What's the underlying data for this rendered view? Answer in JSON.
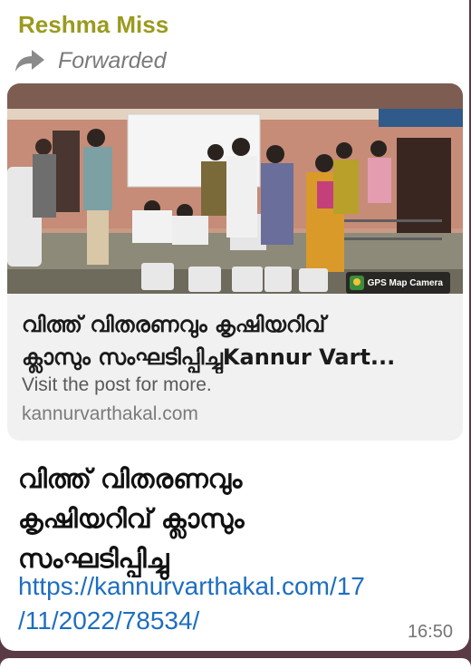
{
  "message": {
    "sender": "Reshma Miss",
    "forwarded_label": "Forwarded",
    "link_preview": {
      "photo_badge": "GPS Map Camera",
      "title_line1": "വിത്ത് വിതരണവും കൃഷിയറിവ്",
      "title_line2": "ക്ലാസും സംഘടിപ്പിച്ചുKannur Vart...",
      "description": "Visit the post for more.",
      "domain": "kannurvarthakal.com"
    },
    "text_lines": [
      "വിത്ത് വിതരണവും",
      "കൃഷിയറിവ് ക്ലാസും",
      "സംഘടിപ്പിച്ചു"
    ],
    "link_lines": [
      "https://kannurvarthakal.com/17",
      "/11/2022/78534/"
    ],
    "time": "16:50"
  },
  "colors": {
    "sender": "#9a9a1f",
    "link": "#1e6ec0",
    "bubble": "#ffffff",
    "preview_bg": "#f1f1f1"
  },
  "icons": {
    "forward": "forward-arrow-icon",
    "gps": "gps-map-camera-icon"
  }
}
